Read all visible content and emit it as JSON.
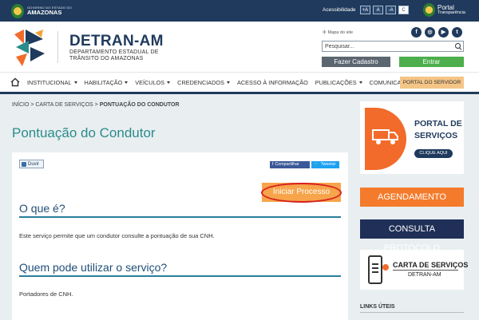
{
  "gov_bar": {
    "gov_small": "GOVERNO DO ESTADO DO",
    "gov_big": "AMAZONAS",
    "accessibility_label": "Acessibilidade",
    "font_buttons": [
      "+A",
      "A",
      "-A",
      "C"
    ],
    "portal_a": "Portal",
    "portal_b": "Transparência"
  },
  "header": {
    "title": "DETRAN-AM",
    "subtitle_line1": "DEPARTAMENTO ESTADUAL DE",
    "subtitle_line2": "TRÂNSITO DO AMAZONAS",
    "sitemap_label": "Mapa do site",
    "social": [
      "f",
      "◎",
      "▶",
      "t"
    ],
    "search_placeholder": "Pesquisar...",
    "cadastro_label": "Fazer Cadastro",
    "entrar_label": "Entrar"
  },
  "nav": {
    "items": [
      {
        "label": "INSTITUCIONAL",
        "dropdown": true
      },
      {
        "label": "HABILITAÇÃO",
        "dropdown": true
      },
      {
        "label": "VEÍCULOS",
        "dropdown": true
      },
      {
        "label": "CREDENCIADOS",
        "dropdown": true
      },
      {
        "label": "ACESSO À INFORMAÇÃO",
        "dropdown": false
      },
      {
        "label": "PUBLICAÇÕES",
        "dropdown": true
      },
      {
        "label": "COMUNICAÇÃO",
        "dropdown": true
      }
    ],
    "servidor_label": "PORTAL DO SERVIDOR"
  },
  "breadcrumb": {
    "home": "INÍCIO",
    "sep": " > ",
    "section": "CARTA DE SERVIÇOS",
    "current": "PONTUAÇÃO DO CONDUTOR"
  },
  "main": {
    "title": "Pontuação do Condutor",
    "duvida_label": "Duvir",
    "share_facebook": "Compartilhar",
    "share_twitter": "Tweetar",
    "iniciar_label": "Iniciar Processo",
    "sections": [
      {
        "title": "O que é?",
        "text": "Este serviço permite que um condutor consulte a pontuação de sua CNH."
      },
      {
        "title": "Quem pode utilizar o serviço?",
        "text": "Portadores de CNH."
      }
    ]
  },
  "sidebar": {
    "portal_word1": "PORTAL DE",
    "portal_word2": "SERVIÇOS",
    "clique_label": "CLIQUE AQUI",
    "agendamento_label": "AGENDAMENTO",
    "protocolo_label": "CONSULTA PROTOCOLO",
    "carta_title": "CARTA DE SERVIÇOS",
    "carta_sub": "DETRAN-AM",
    "links_title": "LINKS ÚTEIS"
  }
}
